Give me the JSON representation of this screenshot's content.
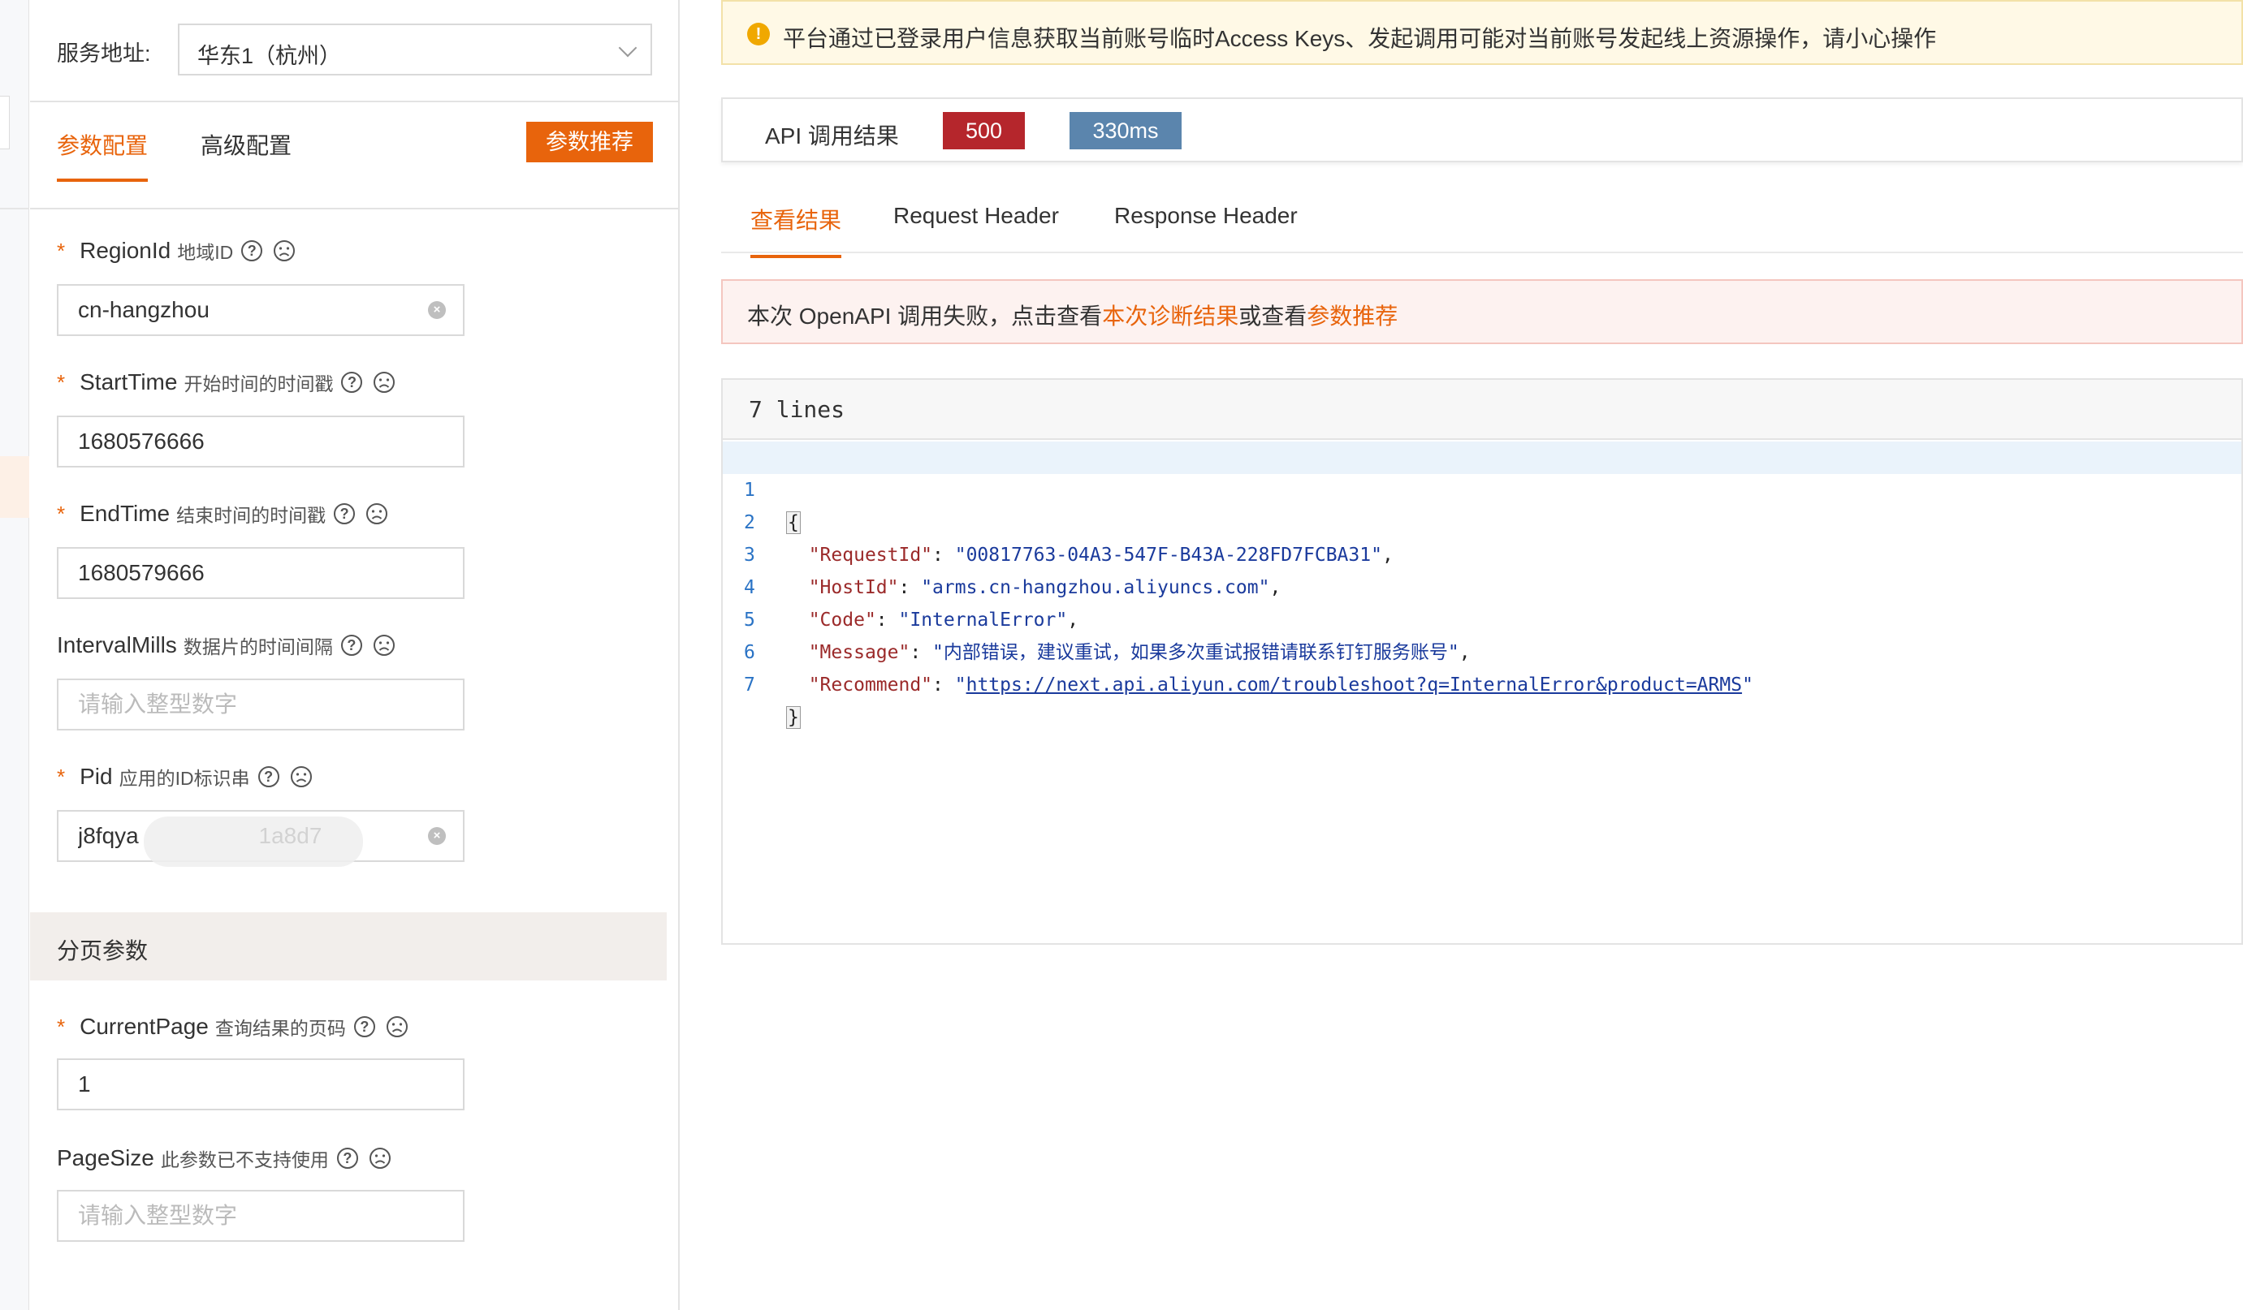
{
  "service": {
    "label": "服务地址:",
    "value": "华东1（杭州）"
  },
  "left_tabs": {
    "params": "参数配置",
    "advanced": "高级配置",
    "recommend_button": "参数推荐"
  },
  "fields": {
    "region": {
      "name": "RegionId",
      "desc": "地域ID",
      "value": "cn-hangzhou",
      "required": true
    },
    "start": {
      "name": "StartTime",
      "desc": "开始时间的时间戳",
      "value": "1680576666",
      "required": true
    },
    "end": {
      "name": "EndTime",
      "desc": "结束时间的时间戳",
      "value": "1680579666",
      "required": true
    },
    "interval": {
      "name": "IntervalMills",
      "desc": "数据片的时间间隔",
      "placeholder": "请输入整型数字",
      "required": false
    },
    "pid": {
      "name": "Pid",
      "desc": "应用的ID标识串",
      "value": "j8fqya                   1a8d7",
      "required": true
    },
    "current_page": {
      "name": "CurrentPage",
      "desc": "查询结果的页码",
      "value": "1",
      "required": true
    },
    "page_size": {
      "name": "PageSize",
      "desc": "此参数已不支持使用",
      "placeholder": "请输入整型数字",
      "required": false
    }
  },
  "section": {
    "pagination": "分页参数"
  },
  "required_mark": "*",
  "help_mark": "?",
  "alert": {
    "text": "平台通过已登录用户信息获取当前账号临时Access Keys、发起调用可能对当前账号发起线上资源操作，请小心操作",
    "icon_mark": "!"
  },
  "result": {
    "title": "API 调用结果",
    "status": "500",
    "time": "330ms"
  },
  "result_tabs": {
    "view": "查看结果",
    "request_header": "Request Header",
    "response_header": "Response Header"
  },
  "error_box": {
    "prefix": "本次 OpenAPI 调用失败，点击查看",
    "link1": "本次诊断结果",
    "middle": "或查看",
    "link2": "参数推荐"
  },
  "code": {
    "header": "7 lines",
    "line_numbers": [
      "1",
      "2",
      "3",
      "4",
      "5",
      "6",
      "7"
    ],
    "open_brace": "{",
    "close_brace": "}",
    "entries": [
      {
        "key": "\"RequestId\"",
        "value": "\"00817763-04A3-547F-B43A-228FD7FCBA31\""
      },
      {
        "key": "\"HostId\"",
        "value": "\"arms.cn-hangzhou.aliyuncs.com\""
      },
      {
        "key": "\"Code\"",
        "value": "\"InternalError\""
      },
      {
        "key": "\"Message\"",
        "value": "\"内部错误，建议重试，如果多次重试报错请联系钉钉服务账号\""
      },
      {
        "key": "\"Recommend\"",
        "value": "https://next.api.aliyun.com/troubleshoot?q=InternalError&product=ARMS"
      }
    ]
  },
  "colors": {
    "accent": "#e8640c",
    "status_error": "#b5262c",
    "time_badge": "#5b85ad"
  }
}
